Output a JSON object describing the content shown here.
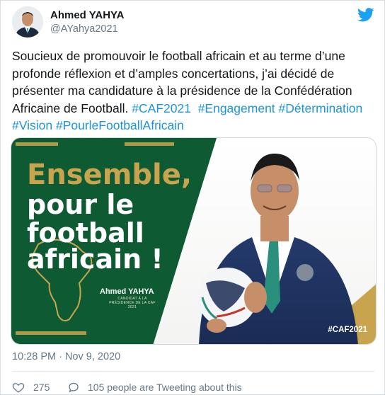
{
  "user": {
    "name": "Ahmed YAHYA",
    "handle": "@AYahya2021"
  },
  "tweet": {
    "text_plain": "Soucieux de promouvoir le football africain et au terme d’une profonde réflexion et d’amples concertations, j’ai décidé de présenter ma candidature à la présidence de la Confédération Africaine de Football.",
    "hashtags": [
      "#CAF2021",
      "#Engagement",
      "#Détermination",
      "#Vision",
      "#PourleFootballAfricain"
    ]
  },
  "media": {
    "headline_1": "Ensemble,",
    "headline_2": "pour le",
    "headline_3": "football",
    "headline_4": "africain !",
    "candidate_name": "Ahmed YAHYA",
    "candidate_sub": "CANDIDAT À LA PRÉSIDENCE DE LA CAF 2021",
    "image_hashtag": "#CAF2021",
    "colors": {
      "green": "#0d5a33",
      "gold": "#c9a44e"
    }
  },
  "meta": {
    "timestamp": "10:28 PM · Nov 9, 2020",
    "like_count": "275",
    "people_text": "105 people are Tweeting about this"
  },
  "icons": {
    "brand": "twitter-bird-icon",
    "like": "heart-icon",
    "conversation": "speech-bubble-icon"
  },
  "colors": {
    "link": "#1b95e0",
    "muted": "#657786",
    "twitter_blue": "#1da1f2"
  }
}
